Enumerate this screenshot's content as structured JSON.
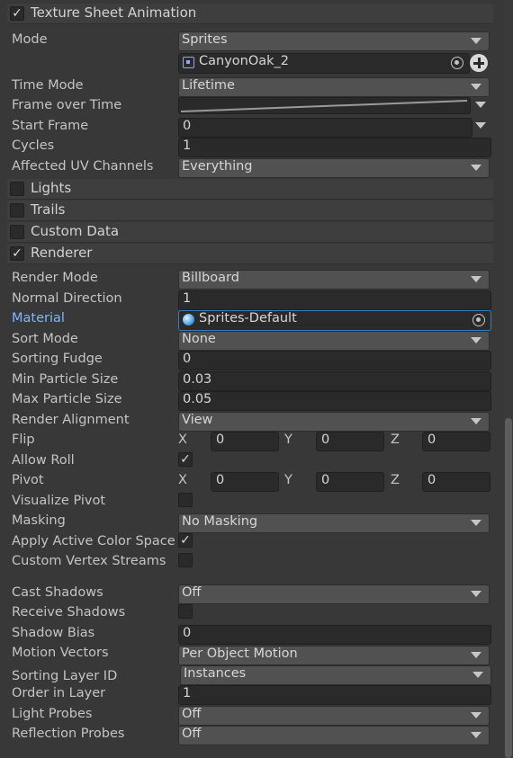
{
  "texture_sheet": {
    "title": "Texture Sheet Animation",
    "checked": true,
    "mode_label": "Mode",
    "mode_value": "Sprites",
    "sprite_value": "CanyonOak_2",
    "time_mode_label": "Time Mode",
    "time_mode_value": "Lifetime",
    "frame_over_time_label": "Frame over Time",
    "start_frame_label": "Start Frame",
    "start_frame_value": "0",
    "cycles_label": "Cycles",
    "cycles_value": "1",
    "uv_label": "Affected UV Channels",
    "uv_value": "Everything"
  },
  "sections": {
    "lights": "Lights",
    "trails": "Trails",
    "custom_data": "Custom Data",
    "renderer": "Renderer"
  },
  "renderer": {
    "render_mode_label": "Render Mode",
    "render_mode_value": "Billboard",
    "normal_direction_label": "Normal Direction",
    "normal_direction_value": "1",
    "material_label": "Material",
    "material_value": "Sprites-Default",
    "sort_mode_label": "Sort Mode",
    "sort_mode_value": "None",
    "sorting_fudge_label": "Sorting Fudge",
    "sorting_fudge_value": "0",
    "min_particle_label": "Min Particle Size",
    "min_particle_value": "0.03",
    "max_particle_label": "Max Particle Size",
    "max_particle_value": "0.05",
    "render_alignment_label": "Render Alignment",
    "render_alignment_value": "View",
    "flip_label": "Flip",
    "flip": {
      "x": "0",
      "y": "0",
      "z": "0"
    },
    "allow_roll_label": "Allow Roll",
    "allow_roll": true,
    "pivot_label": "Pivot",
    "pivot": {
      "x": "0",
      "y": "0",
      "z": "0"
    },
    "axis": {
      "x": "X",
      "y": "Y",
      "z": "Z"
    },
    "visualize_pivot_label": "Visualize Pivot",
    "visualize_pivot": false,
    "masking_label": "Masking",
    "masking_value": "No Masking",
    "apply_color_space_label": "Apply Active Color Space",
    "apply_color_space": true,
    "custom_vertex_label": "Custom Vertex Streams",
    "custom_vertex": false,
    "cast_shadows_label": "Cast Shadows",
    "cast_shadows_value": "Off",
    "receive_shadows_label": "Receive Shadows",
    "receive_shadows": false,
    "shadow_bias_label": "Shadow Bias",
    "shadow_bias_value": "0",
    "motion_vectors_label": "Motion Vectors",
    "motion_vectors_value": "Per Object Motion",
    "sorting_layer_label": "Sorting Layer ID",
    "sorting_layer_value": "Instances",
    "order_in_layer_label": "Order in Layer",
    "order_in_layer_value": "1",
    "light_probes_label": "Light Probes",
    "light_probes_value": "Off",
    "reflection_probes_label": "Reflection Probes",
    "reflection_probes_value": "Off"
  },
  "colors": {
    "panel_bg": "#383838",
    "field_bg": "#2a2a2a",
    "dropdown_bg": "#515151",
    "accent_blue": "#3a79bb",
    "label_blue": "#7fb6ff"
  }
}
